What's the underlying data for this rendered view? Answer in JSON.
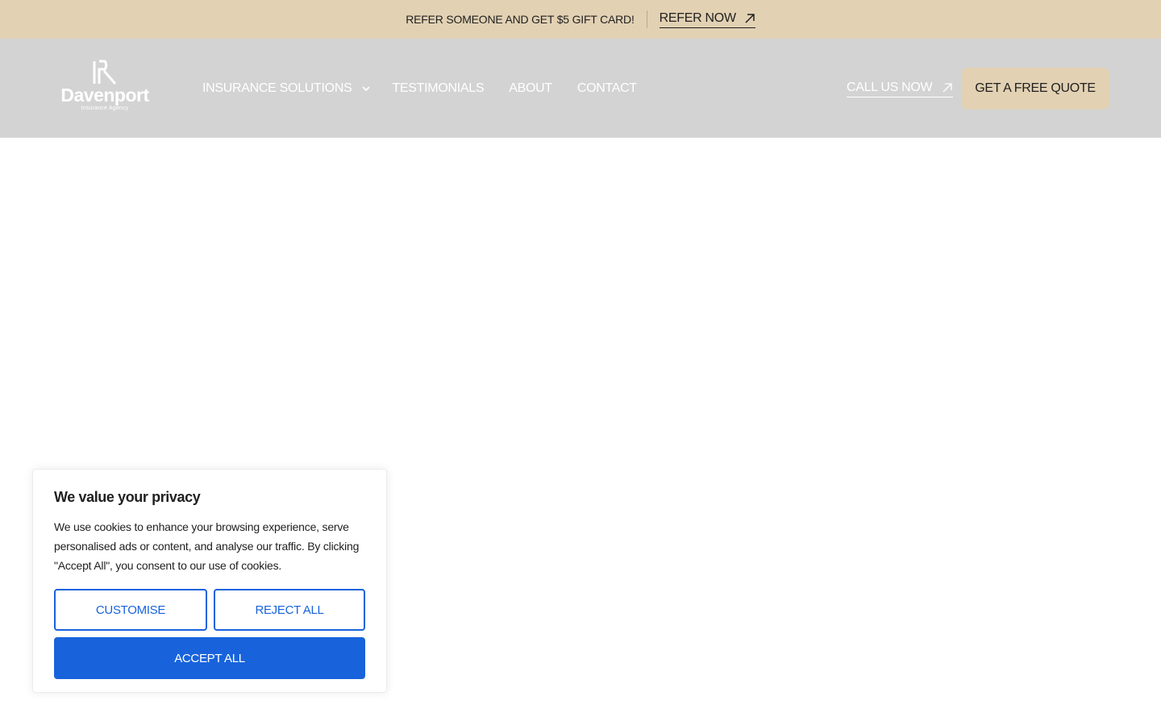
{
  "promo": {
    "text": "REFER SOMEONE AND GET $5 GIFT CARD!",
    "link_label": "REFER NOW"
  },
  "header": {
    "logo_name": "Davenport",
    "logo_sub": "Insurance Agency",
    "nav": [
      {
        "label": "INSURANCE SOLUTIONS",
        "has_dropdown": true
      },
      {
        "label": "TESTIMONIALS"
      },
      {
        "label": "ABOUT"
      },
      {
        "label": "CONTACT"
      }
    ],
    "call_label": "CALL US NOW",
    "quote_label": "GET A FREE QUOTE"
  },
  "cookie": {
    "title": "We value your privacy",
    "text": "We use cookies to enhance your browsing experience, serve personalised ads or content, and analyse our traffic. By clicking \"Accept All\", you consent to our use of cookies.",
    "customise_label": "CUSTOMISE",
    "reject_label": "REJECT ALL",
    "accept_label": "ACCEPT ALL"
  },
  "colors": {
    "promo_bg": "#e2d1b3",
    "header_bg": "#d3d3d3",
    "accent_blue": "#1863dc"
  },
  "icons": [
    "arrow-up-right-icon",
    "chevron-down-icon",
    "logo-mark-icon"
  ]
}
